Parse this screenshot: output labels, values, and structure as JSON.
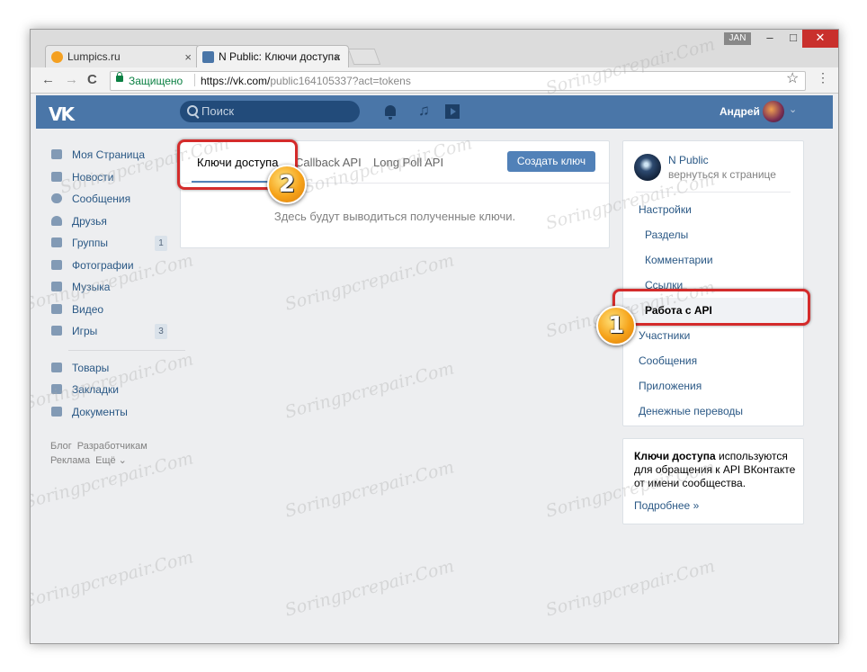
{
  "browser": {
    "tabs": [
      {
        "title": "Lumpics.ru",
        "close": "×"
      },
      {
        "title": "N Public: Ключи доступа",
        "close": "×"
      }
    ],
    "profile": "JAN",
    "window_controls": {
      "minimize": "–",
      "maximize": "□",
      "close": "✕"
    },
    "nav": {
      "back": "←",
      "forward": "→",
      "reload": "C"
    },
    "secure_label": "Защищено",
    "url_host": "https://vk.com/",
    "url_rest": "public164105337?act=tokens",
    "star": "☆",
    "menu": "⋮"
  },
  "header": {
    "logo": "VK",
    "search_placeholder": "Поиск",
    "user_name": "Андрей",
    "chevron": "⌄"
  },
  "left_menu": {
    "items": [
      {
        "label": "Моя Страница",
        "icon": "home-icon"
      },
      {
        "label": "Новости",
        "icon": "news-icon"
      },
      {
        "label": "Сообщения",
        "icon": "messages-icon"
      },
      {
        "label": "Друзья",
        "icon": "friends-icon"
      },
      {
        "label": "Группы",
        "icon": "groups-icon",
        "count": "1"
      },
      {
        "label": "Фотографии",
        "icon": "camera-icon"
      },
      {
        "label": "Музыка",
        "icon": "music-icon"
      },
      {
        "label": "Видео",
        "icon": "video-icon"
      },
      {
        "label": "Игры",
        "icon": "games-icon",
        "count": "3"
      }
    ],
    "items2": [
      {
        "label": "Товары",
        "icon": "shopping-bag-icon"
      },
      {
        "label": "Закладки",
        "icon": "star-icon"
      },
      {
        "label": "Документы",
        "icon": "document-icon"
      }
    ],
    "footer": [
      "Блог",
      "Разработчикам",
      "Реклама",
      "Ещё ⌄"
    ]
  },
  "main": {
    "tabs": [
      "Ключи доступа",
      "Callback API",
      "Long Poll API"
    ],
    "create_button": "Создать ключ",
    "empty_message": "Здесь будут выводиться полученные ключи."
  },
  "right_menu": {
    "group_name": "N Public",
    "back_link": "вернуться к странице",
    "items": [
      "Настройки",
      "Разделы",
      "Комментарии",
      "Ссылки",
      "Работа с API",
      "Участники",
      "Сообщения",
      "Приложения",
      "Денежные переводы"
    ],
    "active_item": "Работа с API"
  },
  "info": {
    "bold": "Ключи доступа",
    "text": " используются для обращения к API ВКонтакте от имени сообщества.",
    "more": "Подробнее »"
  },
  "annotations": {
    "badge1": "1",
    "badge2": "2"
  },
  "watermark": "Soringpcrepair.Com",
  "colors": {
    "vk_blue": "#4a76a8",
    "link": "#2a5885",
    "button": "#5181b8",
    "highlight": "#d42b2b"
  }
}
